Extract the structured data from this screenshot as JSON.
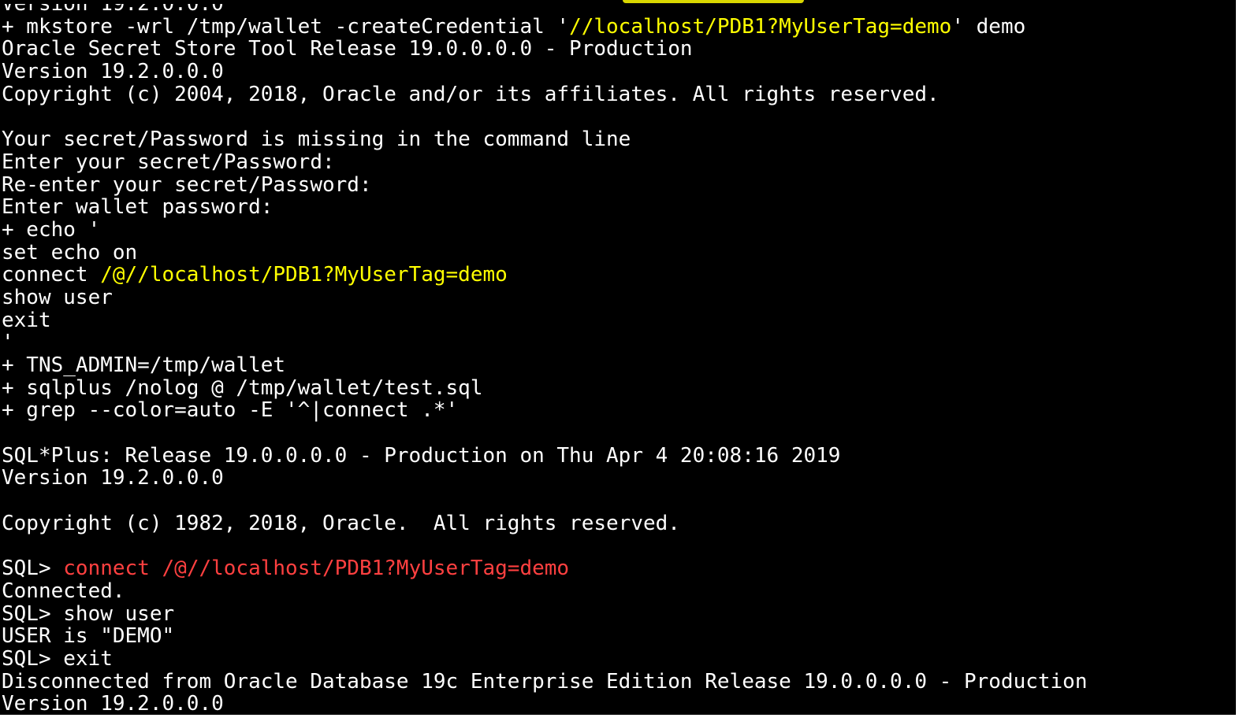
{
  "colors": {
    "background": "#000000",
    "text": "#ffffff",
    "yellow": "#ffff00",
    "red": "#ff4040"
  },
  "lines": [
    [
      {
        "t": "Version 19.2.0.0.0"
      }
    ],
    [
      {
        "t": "+ mkstore -wrl /tmp/wallet -createCredential '"
      },
      {
        "t": "//localhost/PDB1?MyUserTag=demo",
        "c": "yellow"
      },
      {
        "t": "' demo"
      }
    ],
    [
      {
        "t": "Oracle Secret Store Tool Release 19.0.0.0.0 - Production"
      }
    ],
    [
      {
        "t": "Version 19.2.0.0.0"
      }
    ],
    [
      {
        "t": "Copyright (c) 2004, 2018, Oracle and/or its affiliates. All rights reserved."
      }
    ],
    [
      {
        "t": ""
      }
    ],
    [
      {
        "t": "Your secret/Password is missing in the command line"
      }
    ],
    [
      {
        "t": "Enter your secret/Password:"
      }
    ],
    [
      {
        "t": "Re-enter your secret/Password:"
      }
    ],
    [
      {
        "t": "Enter wallet password:"
      }
    ],
    [
      {
        "t": "+ echo '"
      }
    ],
    [
      {
        "t": "set echo on"
      }
    ],
    [
      {
        "t": "connect "
      },
      {
        "t": "/@//localhost/PDB1?MyUserTag=demo",
        "c": "yellow"
      }
    ],
    [
      {
        "t": "show user"
      }
    ],
    [
      {
        "t": "exit"
      }
    ],
    [
      {
        "t": "'"
      }
    ],
    [
      {
        "t": "+ TNS_ADMIN=/tmp/wallet"
      }
    ],
    [
      {
        "t": "+ sqlplus /nolog @ /tmp/wallet/test.sql"
      }
    ],
    [
      {
        "t": "+ grep --color=auto -E '^|connect .*'"
      }
    ],
    [
      {
        "t": ""
      }
    ],
    [
      {
        "t": "SQL*Plus: Release 19.0.0.0.0 - Production on Thu Apr 4 20:08:16 2019"
      }
    ],
    [
      {
        "t": "Version 19.2.0.0.0"
      }
    ],
    [
      {
        "t": ""
      }
    ],
    [
      {
        "t": "Copyright (c) 1982, 2018, Oracle.  All rights reserved."
      }
    ],
    [
      {
        "t": ""
      }
    ],
    [
      {
        "t": "SQL> "
      },
      {
        "t": "connect /@//localhost/PDB1?MyUserTag=demo",
        "c": "red"
      }
    ],
    [
      {
        "t": "Connected."
      }
    ],
    [
      {
        "t": "SQL> show user"
      }
    ],
    [
      {
        "t": "USER is \"DEMO\""
      }
    ],
    [
      {
        "t": "SQL> exit"
      }
    ],
    [
      {
        "t": "Disconnected from Oracle Database 19c Enterprise Edition Release 19.0.0.0.0 - Production"
      }
    ],
    [
      {
        "t": "Version 19.2.0.0.0"
      }
    ]
  ]
}
